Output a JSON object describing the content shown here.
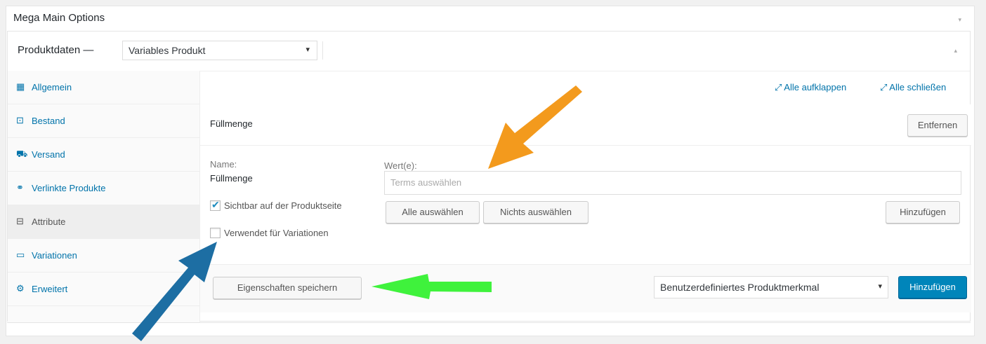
{
  "mega": {
    "title": "Mega Main Options",
    "toggle_icon": "▾"
  },
  "product_data": {
    "label": "Produktdaten —",
    "type_selected": "Variables Produkt",
    "caret": "▾",
    "toggle_icon": "▴"
  },
  "tabs": [
    {
      "label": "Allgemein",
      "icon": "grid-icon",
      "glyph": "▦"
    },
    {
      "label": "Bestand",
      "icon": "inventory-icon",
      "glyph": "⊡"
    },
    {
      "label": "Versand",
      "icon": "truck-icon",
      "glyph": "⛟"
    },
    {
      "label": "Verlinkte Produkte",
      "icon": "link-icon",
      "glyph": "⚭"
    },
    {
      "label": "Attribute",
      "icon": "attributes-icon",
      "glyph": "⊟"
    },
    {
      "label": "Variationen",
      "icon": "variations-icon",
      "glyph": "▭"
    },
    {
      "label": "Erweitert",
      "icon": "gear-icon",
      "glyph": "⚙"
    }
  ],
  "expand": {
    "expand_all": "Alle aufklappen",
    "close_all": "Alle schließen"
  },
  "attribute": {
    "name": "Füllmenge",
    "remove_label": "Entfernen",
    "name_label": "Name:",
    "name_value": "Füllmenge",
    "values_label": "Wert(e):",
    "terms_placeholder": "Terms auswählen",
    "visible_label": "Sichtbar auf der Produktseite",
    "visible_checked": true,
    "variations_label": "Verwendet für Variationen",
    "variations_checked": false,
    "select_all": "Alle auswählen",
    "select_none": "Nichts auswählen",
    "add_term": "Hinzufügen"
  },
  "footer": {
    "save_label": "Eigenschaften speichern",
    "custom_attr_selected": "Benutzerdefiniertes Produktmerkmal",
    "add_label": "Hinzufügen"
  },
  "colors": {
    "annotation_orange": "#f39a1d",
    "annotation_green": "#3ff23c",
    "annotation_blue": "#1d6ea3",
    "primary": "#0085ba"
  }
}
